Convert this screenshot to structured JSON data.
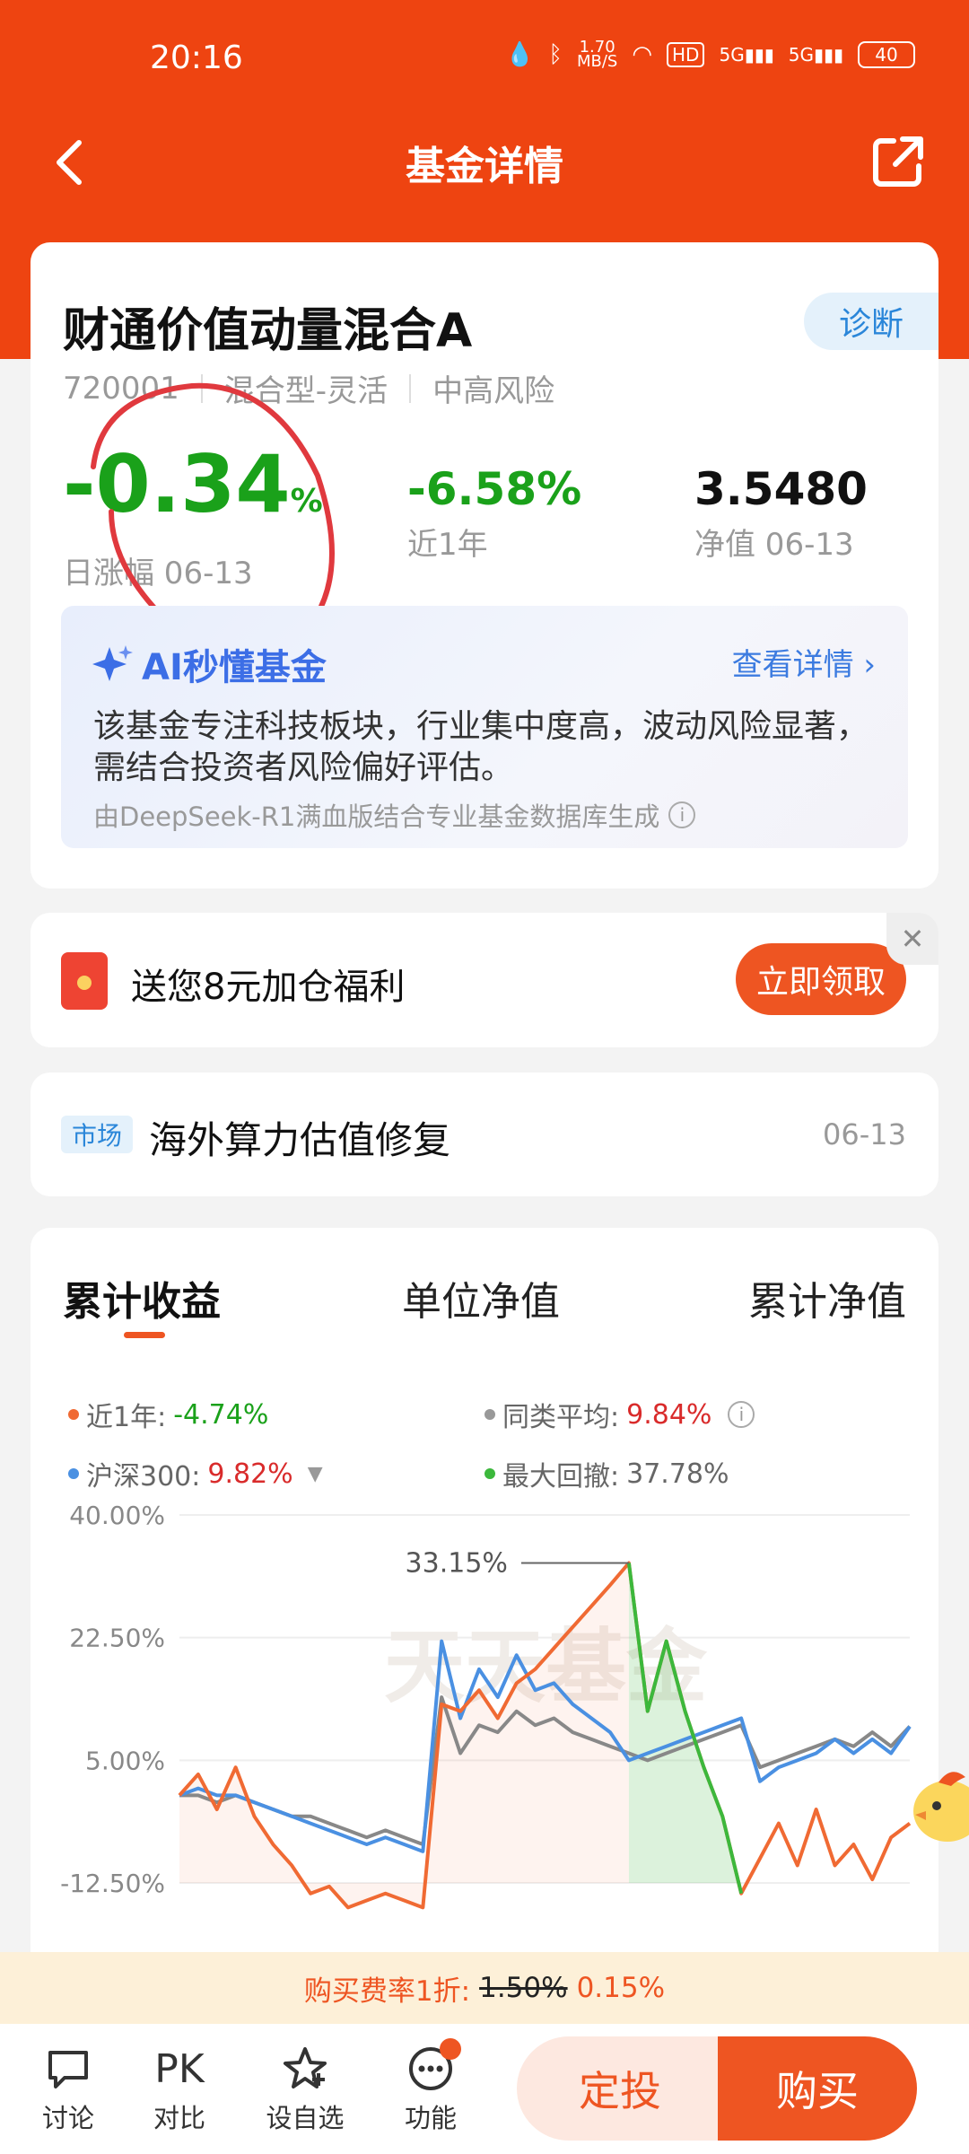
{
  "status": {
    "time": "20:16",
    "net_speed_top": "1.70",
    "net_speed_bottom": "MB/S",
    "hd": "HD",
    "sig1": "5G",
    "sig2": "5G",
    "battery": "40"
  },
  "nav": {
    "title": "基金详情"
  },
  "fund": {
    "name": "财通价值动量混合A",
    "diagnose_label": "诊断",
    "code": "720001",
    "type": "混合型-灵活",
    "risk": "中高风险",
    "daily_change": "-0.34",
    "daily_change_unit": "%",
    "daily_label": "日涨幅 06-13",
    "year_change": "-6.58%",
    "year_label": "近1年",
    "nav_value": "3.5480",
    "nav_label": "净值 06-13"
  },
  "ai": {
    "title": "AI秒懂基金",
    "more": "查看详情",
    "text": "该基金专注科技板块，行业集中度高，波动风险显著，需结合投资者风险偏好评估。",
    "footer": "由DeepSeek-R1满血版结合专业基金数据库生成"
  },
  "promo": {
    "text": "送您8元加仓福利",
    "button": "立即领取"
  },
  "news": {
    "tag": "市场",
    "title": "海外算力估值修复",
    "date": "06-13"
  },
  "chart": {
    "tabs": [
      "累计收益",
      "单位净值",
      "累计净值"
    ],
    "legend": {
      "near_year_label": "近1年:",
      "near_year_value": "-4.74%",
      "peer_label": "同类平均:",
      "peer_value": "9.84%",
      "hs300_label": "沪深300:",
      "hs300_value": "9.82%",
      "mdd_label": "最大回撤:",
      "mdd_value": "37.78%"
    },
    "watermark": "天天基金",
    "peak_label": "33.15%",
    "colors": {
      "fund": "#f06a33",
      "hs300": "#4a90e2",
      "peer": "#888888",
      "drawdown": "#3cb83c"
    }
  },
  "chart_data": {
    "type": "line",
    "ylim": [
      -12.5,
      40
    ],
    "yticks": [
      "40.00%",
      "22.50%",
      "5.00%",
      "-12.50%"
    ],
    "ytick_values": [
      40,
      22.5,
      5,
      -12.5
    ],
    "series": [
      {
        "name": "近1年",
        "values": [
          0,
          3,
          -2,
          4,
          -3,
          -7,
          -10,
          -14,
          -13,
          -16,
          -15,
          -14,
          -15,
          -16,
          13,
          12,
          15,
          11,
          16,
          18,
          21,
          24,
          27,
          30,
          33.15,
          12,
          22,
          12,
          4,
          -3,
          -14,
          -9,
          -4,
          -10,
          -2,
          -10,
          -7,
          -12,
          -6,
          -4
        ]
      },
      {
        "name": "沪深300",
        "values": [
          0,
          1,
          0,
          0,
          -1,
          -2,
          -3,
          -4,
          -5,
          -6,
          -7,
          -6,
          -7,
          -8,
          22,
          11,
          18,
          14,
          20,
          15,
          16,
          13,
          11,
          9,
          5,
          6,
          7,
          8,
          9,
          10,
          11,
          2,
          4,
          5,
          6,
          8,
          6,
          8,
          6,
          9.82
        ]
      },
      {
        "name": "同类平均",
        "values": [
          0,
          0,
          -1,
          0,
          -1,
          -2,
          -3,
          -3,
          -4,
          -5,
          -6,
          -5,
          -6,
          -7,
          14,
          6,
          10,
          9,
          12,
          10,
          11,
          9,
          8,
          7,
          6,
          5,
          6,
          7,
          8,
          9,
          10,
          4,
          5,
          6,
          7,
          8,
          7,
          9,
          7,
          9.84
        ]
      }
    ]
  },
  "fee": {
    "label": "购买费率1折:",
    "original": "1.50%",
    "discounted": "0.15%"
  },
  "bottom": {
    "discuss": "讨论",
    "pk_icon": "PK",
    "compare": "对比",
    "watchlist": "设自选",
    "functions": "功能",
    "dingtou": "定投",
    "buy": "购买"
  }
}
